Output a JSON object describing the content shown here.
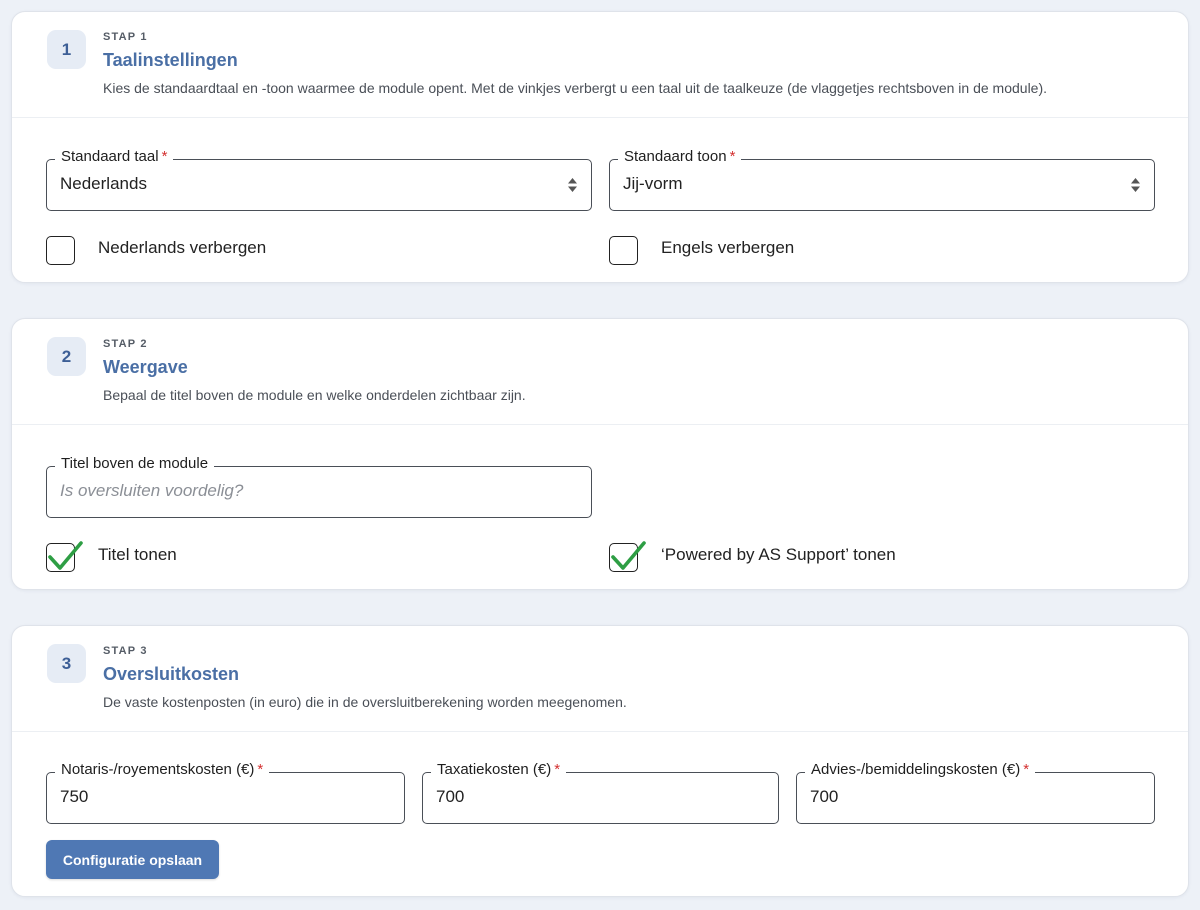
{
  "steps": [
    {
      "number": "1",
      "eyebrow": "STAP 1",
      "title": "Taalinstellingen",
      "description": "Kies de standaardtaal en -toon waarmee de module opent. Met de vinkjes verbergt u een taal uit de taalkeuze (de vlaggetjes rechtsboven in de module).",
      "fields": {
        "language": {
          "label": "Standaard taal",
          "value": "Nederlands",
          "required": "*"
        },
        "tone": {
          "label": "Standaard toon",
          "value": "Jij-vorm",
          "required": "*"
        }
      },
      "checkboxes": {
        "hide_dutch": {
          "label": "Nederlands verbergen",
          "checked": false
        },
        "hide_english": {
          "label": "Engels verbergen",
          "checked": false
        }
      }
    },
    {
      "number": "2",
      "eyebrow": "STAP 2",
      "title": "Weergave",
      "description": "Bepaal de titel boven de module en welke onderdelen zichtbaar zijn.",
      "fields": {
        "module_title": {
          "label": "Titel boven de module",
          "value": "",
          "placeholder": "Is oversluiten voordelig?"
        }
      },
      "checkboxes": {
        "show_title": {
          "label": "Titel tonen",
          "checked": true
        },
        "show_powered": {
          "label": "‘Powered by AS Support’ tonen",
          "checked": true
        }
      }
    },
    {
      "number": "3",
      "eyebrow": "STAP 3",
      "title": "Oversluitkosten",
      "description": "De vaste kostenposten (in euro) die in de oversluitberekening worden meegenomen.",
      "fields": {
        "notary": {
          "label": "Notaris-/royementskosten (€)",
          "value": "750",
          "required": "*"
        },
        "valuation": {
          "label": "Taxatiekosten (€)",
          "value": "700",
          "required": "*"
        },
        "advice": {
          "label": "Advies-/bemiddelingskosten (€)",
          "value": "700",
          "required": "*"
        }
      }
    }
  ],
  "save_label": "Configuratie opslaan",
  "colors": {
    "accent": "#4a6fa5",
    "button": "#4f78b4",
    "checkmark": "#2e9e44",
    "required": "#d32f2f",
    "background": "#edf1f7"
  }
}
